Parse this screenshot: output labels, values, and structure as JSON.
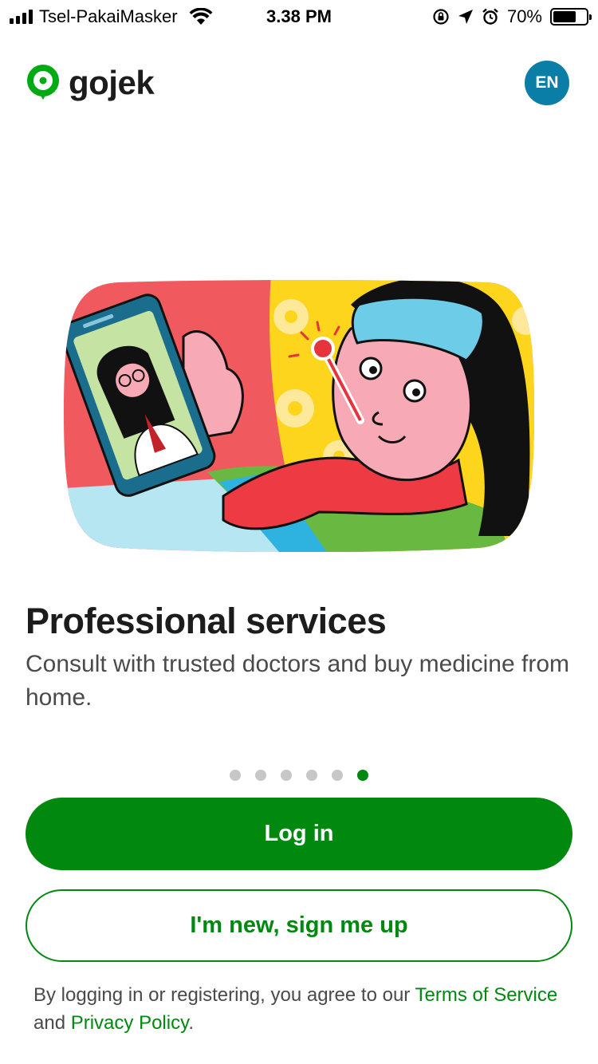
{
  "status_bar": {
    "carrier": "Tsel-PakaiMasker",
    "time": "3.38 PM",
    "battery": "70%",
    "battery_level": 0.7
  },
  "header": {
    "logo_text": "gojek",
    "language_button": "EN"
  },
  "slide": {
    "title": "Professional services",
    "description": "Consult with trusted doctors and buy medicine from home.",
    "page_count": 6,
    "active_page": 6
  },
  "buttons": {
    "login": "Log in",
    "signup": "I'm new, sign me up"
  },
  "legal": {
    "prefix": "By logging in or registering, you agree to our ",
    "terms": "Terms of Service",
    "middle": " and ",
    "privacy": "Privacy Policy",
    "suffix": "."
  },
  "colors": {
    "brand_green": "#00880f",
    "lang_blue": "#0a7ea7"
  },
  "icons": [
    "signal-icon",
    "wifi-icon",
    "orientation-lock-icon",
    "location-icon",
    "alarm-icon",
    "battery-icon",
    "gojek-logo-icon"
  ]
}
